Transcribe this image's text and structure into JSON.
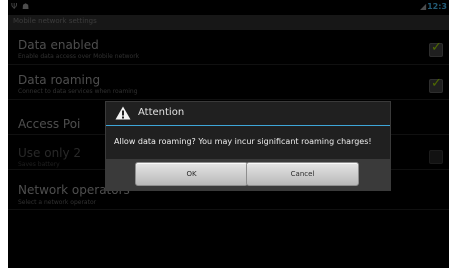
{
  "status_bar": {
    "usb_icon": "usb-icon",
    "android_icon": "android-icon",
    "signal_icon": "signal-icon",
    "clock": "12:3"
  },
  "header": {
    "title": "Mobile network settings"
  },
  "prefs": [
    {
      "title": "Data enabled",
      "summary": "Enable data access over Mobile network",
      "checked": true
    },
    {
      "title": "Data roaming",
      "summary": "Connect to data services when roaming",
      "checked": true
    },
    {
      "title": "Access Poi",
      "summary": ""
    },
    {
      "title": "Use only 2",
      "summary": "Saves battery",
      "checked": false
    },
    {
      "title": "Network operators",
      "summary": "Select a network operator"
    }
  ],
  "dialog": {
    "icon": "alert-icon",
    "title": "Attention",
    "message": "Allow data roaming? You may incur significant roaming charges!",
    "ok_label": "OK",
    "cancel_label": "Cancel"
  },
  "colors": {
    "accent": "#3ea6d8",
    "check": "#8ec000"
  }
}
